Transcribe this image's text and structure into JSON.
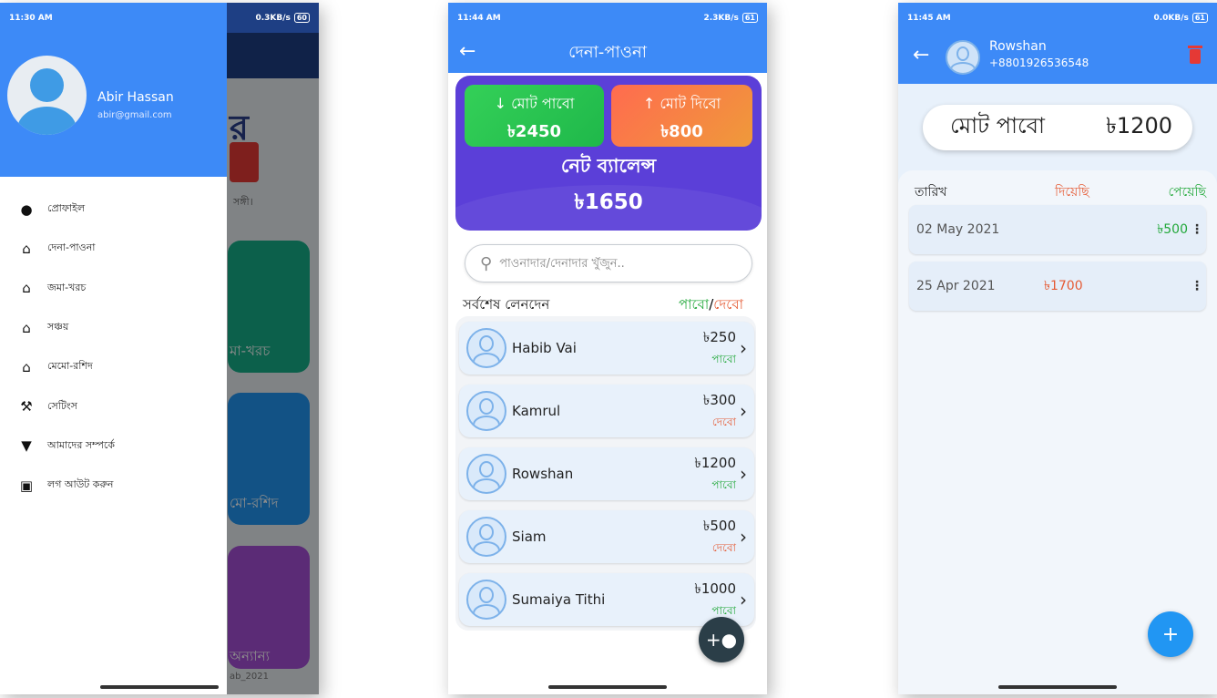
{
  "phone1": {
    "status": {
      "time": "11:30 AM",
      "speed": "0.3KB/s",
      "battery": "60"
    },
    "drawer": {
      "user_name": "Abir Hassan",
      "user_email": "abir@gmail.com",
      "items": [
        {
          "label": "প্রোফাইল",
          "icon": "person-icon"
        },
        {
          "label": "দেনা-পাওনা",
          "icon": "home-icon"
        },
        {
          "label": "জমা-খরচ",
          "icon": "home-icon"
        },
        {
          "label": "সঞ্চয়",
          "icon": "home-icon"
        },
        {
          "label": "মেমো-রশিদ",
          "icon": "home-icon"
        },
        {
          "label": "সেটিংস",
          "icon": "wrench-icon"
        },
        {
          "label": "আমাদের সম্পর্কে",
          "icon": "info-icon"
        },
        {
          "label": "লগ আউট করুন",
          "icon": "delete-icon"
        }
      ]
    },
    "background": {
      "tile1": "মা-খরচ",
      "tile2": "মো-রশিদ",
      "tile3": "অন্যান্য",
      "footer": "ab_2021",
      "sangi": "সঙ্গী।"
    }
  },
  "phone2": {
    "status": {
      "time": "11:44 AM",
      "speed": "2.3KB/s",
      "battery": "61"
    },
    "title": "দেনা-পাওনা",
    "summary": {
      "receive_label": "মোট পাবো",
      "receive_value": "৳2450",
      "give_label": "মোট দিবো",
      "give_value": "৳800",
      "net_label": "নেট ব্যালেন্স",
      "net_value": "৳1650"
    },
    "search": {
      "placeholder": "পাওনাদার/দেনাদার খুঁজুন.."
    },
    "list_header": {
      "left": "সর্বশেষ লেনদেন",
      "right_green": "পাবো",
      "sep": "/",
      "right_red": "দেবো"
    },
    "transactions": [
      {
        "name": "Habib Vai",
        "amount": "৳250",
        "type": "পাবো",
        "color": "#22a83a"
      },
      {
        "name": "Kamrul",
        "amount": "৳300",
        "type": "দেবো",
        "color": "#e55b35"
      },
      {
        "name": "Rowshan",
        "amount": "৳1200",
        "type": "পাবো",
        "color": "#22a83a"
      },
      {
        "name": "Siam",
        "amount": "৳500",
        "type": "দেবো",
        "color": "#e55b35"
      },
      {
        "name": "Sumaiya Tithi",
        "amount": "৳1000",
        "type": "পাবো",
        "color": "#22a83a"
      }
    ]
  },
  "phone3": {
    "status": {
      "time": "11:45 AM",
      "speed": "0.0KB/s",
      "battery": "61"
    },
    "contact_name": "Rowshan",
    "contact_phone": "+8801926536548",
    "total_label": "মোট পাবো",
    "total_value": "৳1200",
    "headers": {
      "date": "তারিখ",
      "given": "দিয়েছি",
      "received": "পেয়েছি"
    },
    "rows": [
      {
        "date": "02 May 2021",
        "given": "",
        "received": "৳500"
      },
      {
        "date": "25 Apr 2021",
        "given": "৳1700",
        "received": ""
      }
    ]
  },
  "colors": {
    "primary_blue": "#3d8af7",
    "green": "#22a83a",
    "red": "#e55b35",
    "purple": "#5b3fd8"
  }
}
